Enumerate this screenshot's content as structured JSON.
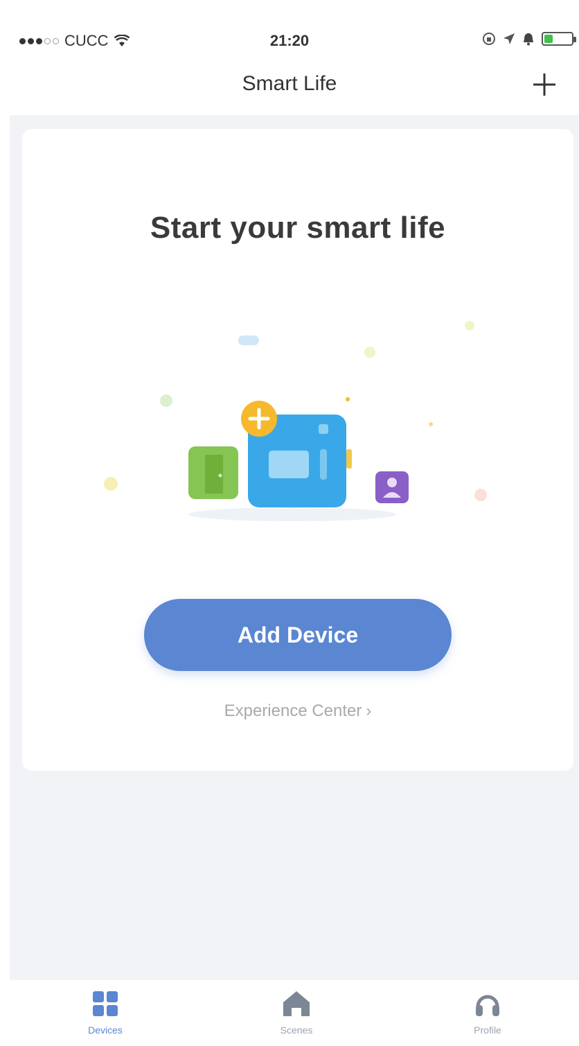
{
  "status_bar": {
    "carrier": "CUCC",
    "time": "21:20"
  },
  "nav": {
    "title": "Smart Life",
    "add_icon": "plus-icon"
  },
  "empty_state": {
    "title": "Start your smart life",
    "illustration_icons": [
      "door-icon",
      "hub-device-icon",
      "person-badge-icon",
      "plus-badge-icon"
    ],
    "add_device_label": "Add Device",
    "experience_center_label": "Experience Center",
    "experience_center_chevron": "›"
  },
  "tab_bar": {
    "tabs": [
      {
        "label": "Devices",
        "icon": "grid-icon",
        "active": true
      },
      {
        "label": "Scenes",
        "icon": "home-icon",
        "active": false
      },
      {
        "label": "Profile",
        "icon": "headset-icon",
        "active": false
      }
    ]
  },
  "colors": {
    "accent": "#5a86d2",
    "background": "#f2f3f6",
    "card": "#ffffff",
    "device_blue": "#3aa8e8",
    "door_green": "#86c454",
    "badge_orange": "#f6b82c",
    "person_purple": "#8a5fc7"
  }
}
